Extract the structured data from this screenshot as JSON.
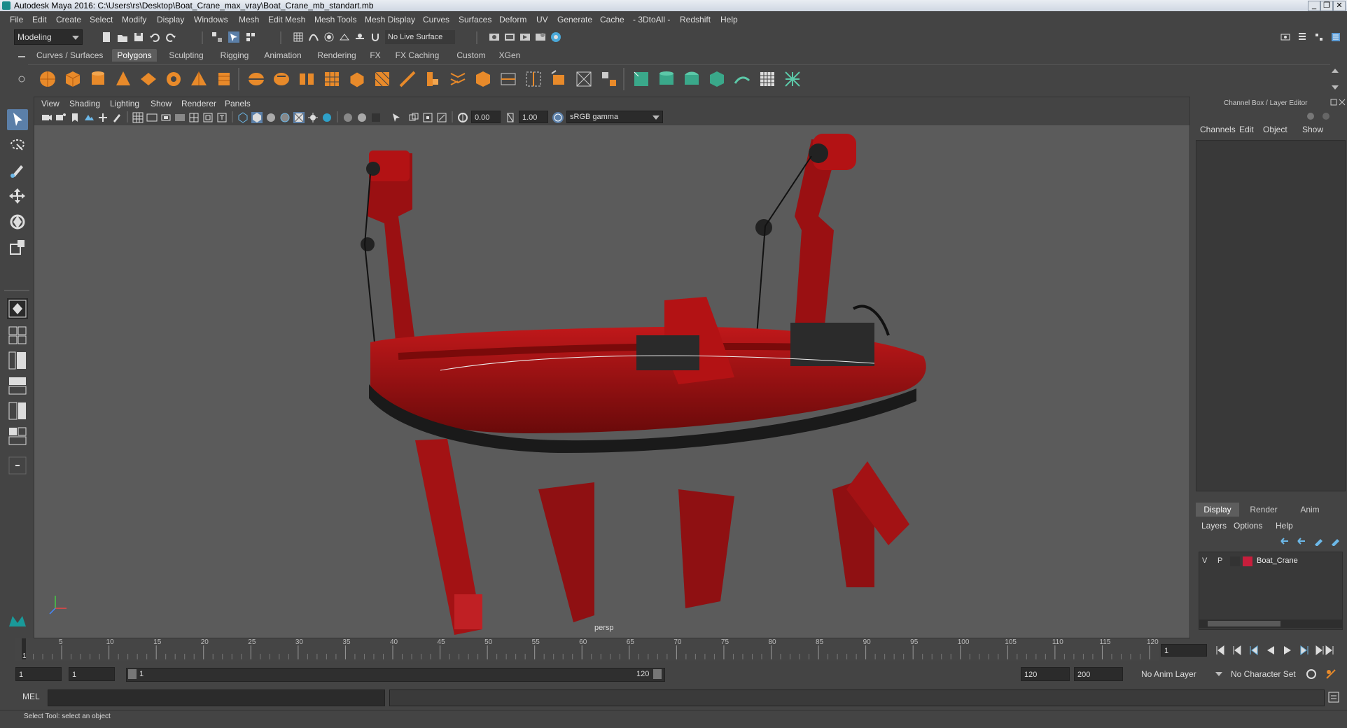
{
  "window": {
    "title": "Autodesk Maya 2016: C:\\Users\\rs\\Desktop\\Boat_Crane_max_vray\\Boat_Crane_mb_standart.mb",
    "controls": [
      "_",
      "❐",
      "✕"
    ]
  },
  "menubar": [
    "File",
    "Edit",
    "Create",
    "Select",
    "Modify",
    "Display",
    "Windows",
    "Mesh",
    "Edit Mesh",
    "Mesh Tools",
    "Mesh Display",
    "Curves",
    "Surfaces",
    "Deform",
    "UV",
    "Generate",
    "Cache",
    "- 3DtoAll -",
    "Redshift",
    "Help"
  ],
  "statusline": {
    "mode": "Modeling",
    "live_surface": "No Live Surface"
  },
  "shelf_tabs": {
    "active": "Polygons",
    "items": [
      "Curves / Surfaces",
      "Polygons",
      "Sculpting",
      "Rigging",
      "Animation",
      "Rendering",
      "FX",
      "FX Caching",
      "Custom",
      "XGen"
    ]
  },
  "viewport": {
    "menu": [
      "View",
      "Shading",
      "Lighting",
      "Show",
      "Renderer",
      "Panels"
    ],
    "exposure": "0.00",
    "gamma": "1.00",
    "color_space": "sRGB gamma",
    "camera_label": "persp"
  },
  "channel_box": {
    "header": "Channel Box / Layer Editor",
    "menu": [
      "Channels",
      "Edit",
      "Object",
      "Show"
    ]
  },
  "layer_editor": {
    "tabs": [
      "Display",
      "Render",
      "Anim"
    ],
    "active_tab": "Display",
    "menu": [
      "Layers",
      "Options",
      "Help"
    ],
    "layers": [
      {
        "visible": "V",
        "playback": "P",
        "name": "Boat_Crane",
        "color": "#c81e3c"
      }
    ]
  },
  "timeline": {
    "ticks": [
      5,
      10,
      15,
      20,
      25,
      30,
      35,
      40,
      45,
      50,
      55,
      60,
      65,
      70,
      75,
      80,
      85,
      90,
      95,
      100,
      105,
      110,
      115,
      120
    ],
    "start_marker": "1",
    "current_frame": "1"
  },
  "range": {
    "start": "1",
    "playback_start": "1",
    "slider_start": "1",
    "slider_end": "120",
    "playback_end": "120",
    "end": "200",
    "anim_layer": "No Anim Layer",
    "character_set": "No Character Set"
  },
  "command_line": {
    "label": "MEL"
  },
  "help_line": "Select Tool: select an object",
  "colors": {
    "accent": "#5b9bd5",
    "boat_red": "#b31214",
    "layer_color": "#c81e3c"
  }
}
